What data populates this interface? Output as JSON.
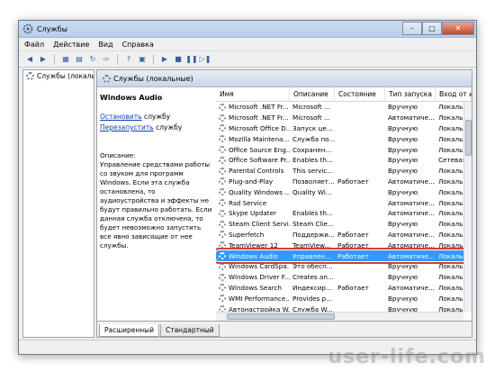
{
  "window": {
    "title": "Службы"
  },
  "menu": [
    "Файл",
    "Действие",
    "Вид",
    "Справка"
  ],
  "tree": {
    "root": "Службы (локальны"
  },
  "main": {
    "header": "Службы (локальные)"
  },
  "desc": {
    "service_name": "Windows Audio",
    "stop_link": "Остановить",
    "stop_suffix": " службу",
    "restart_link": "Перезапустить",
    "restart_suffix": " службу",
    "description": "Описание:\nУправление средствами работы со звуком для программ Windows. Если эта служба остановлена, то аудиоустройства и эффекты не будут правильно работать. Если данная служба отключена, то будет невозможно запустить все явно зависящие от нее службы."
  },
  "columns": [
    "Имя",
    "Описание",
    "Состояние",
    "Тип запуска",
    "Вход от и"
  ],
  "rows": [
    [
      "Microsoft .NET Fr...",
      "Microsoft ...",
      "",
      "Вручную",
      "Локальн"
    ],
    [
      "Microsoft .NET Fr...",
      "Microsoft ...",
      "",
      "Автоматиче...",
      "Локальн"
    ],
    [
      "Microsoft Office D...",
      "Запуск це...",
      "",
      "Вручную",
      "Локальн"
    ],
    [
      "Mozilla Maintena...",
      "Служба по...",
      "",
      "Вручную",
      "Локальн"
    ],
    [
      "Office Source Eng...",
      "Сохранен...",
      "",
      "Вручную",
      "Локальн"
    ],
    [
      "Office Software Pr...",
      "Enables th...",
      "",
      "Вручную",
      "Сетевая"
    ],
    [
      "Parental Controls",
      "This servic...",
      "",
      "Вручную",
      "Локальн"
    ],
    [
      "Plug-and-Play",
      "Позволяет...",
      "Работает",
      "Автоматиче...",
      "Локальн"
    ],
    [
      "Quality Windows ...",
      "Quality Wi...",
      "",
      "Вручную",
      "Локальн"
    ],
    [
      "Rsd Service",
      "",
      "",
      "Автоматиче...",
      "Локальн"
    ],
    [
      "Skype Updater",
      "Enables th...",
      "",
      "Автоматиче...",
      "Локальн"
    ],
    [
      "Steam Client Servi...",
      "Steam Clie...",
      "",
      "Вручную",
      "Локальн"
    ],
    [
      "Superfetch",
      "Поддержи...",
      "Работает",
      "Автоматиче...",
      "Локальн"
    ],
    [
      "TeamViewer 12",
      "TeamView...",
      "Работает",
      "Автоматиче...",
      "Локальн"
    ],
    [
      "Windows Audio",
      "Управлен...",
      "Работает",
      "Автоматиче...",
      "Локальн"
    ],
    [
      "Windows CardSpa...",
      "Это обесп...",
      "",
      "Вручную",
      "Локальн"
    ],
    [
      "Windows Driver F...",
      "Creates an...",
      "",
      "Вручную",
      "Локальн"
    ],
    [
      "Windows Search",
      "Индексир...",
      "Работает",
      "Автоматиче...",
      "Локальн"
    ],
    [
      "WMI Performance...",
      "Provides p...",
      "",
      "Вручную",
      "Локальн"
    ],
    [
      "Автонастройка W...",
      "Служба W...",
      "",
      "Вручную",
      "Локальн"
    ]
  ],
  "selected_row": 14,
  "tabs": {
    "extended": "Расширенный",
    "standard": "Стандартный"
  },
  "watermark": "user-life.com"
}
